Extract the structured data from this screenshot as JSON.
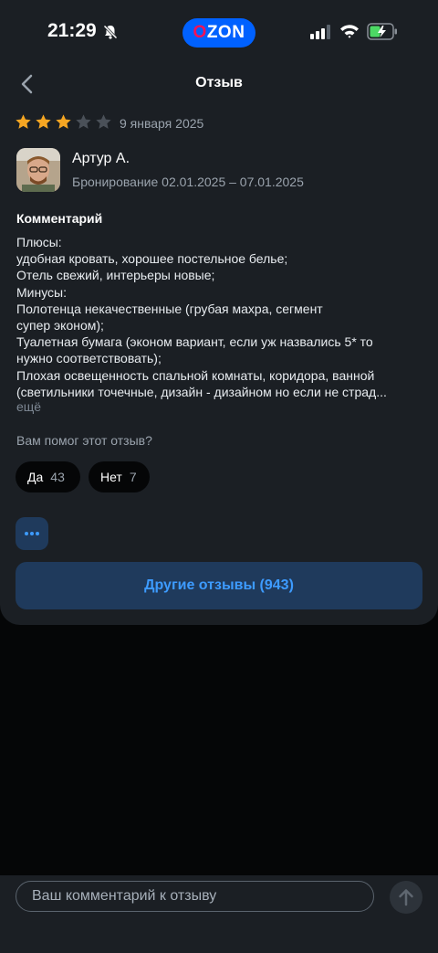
{
  "status_bar": {
    "time": "21:29",
    "logo_text_first": "O",
    "logo_text_rest": "ZON"
  },
  "header": {
    "title": "Отзыв"
  },
  "review": {
    "rating": 3,
    "max_rating": 5,
    "date": "9 января 2025",
    "author": "Артур А.",
    "booking": "Бронирование 02.01.2025 – 07.01.2025",
    "section_title": "Комментарий",
    "comment_lines": [
      "Плюсы:",
      "удобная кровать, хорошее постельное белье;",
      "Отель свежий, интерьеры новые;",
      "Минусы:",
      "Полотенца некачественные (грубая махра, сегмент",
      "супер эконом);",
      "Туалетная бумага (эконом вариант, если уж назвались 5* то",
      "нужно соответствовать);",
      "Плохая освещенность спальной комнаты, коридора, ванной",
      "(светильники точечные, дизайн - дизайном но если не страд..."
    ],
    "more_label": "ещё"
  },
  "helpful": {
    "question": "Вам помог этот отзыв?",
    "yes_label": "Да",
    "yes_count": "43",
    "no_label": "Нет",
    "no_count": "7"
  },
  "actions": {
    "other_reviews_label": "Другие отзывы (943)"
  },
  "comment_box": {
    "placeholder": "Ваш комментарий к отзыву"
  },
  "colors": {
    "background": "#050607",
    "card": "#1b1f24",
    "star_filled": "#f5a623",
    "star_empty": "#4a5058",
    "accent": "#3d9bff",
    "accent_bg": "#1f3a5c"
  }
}
